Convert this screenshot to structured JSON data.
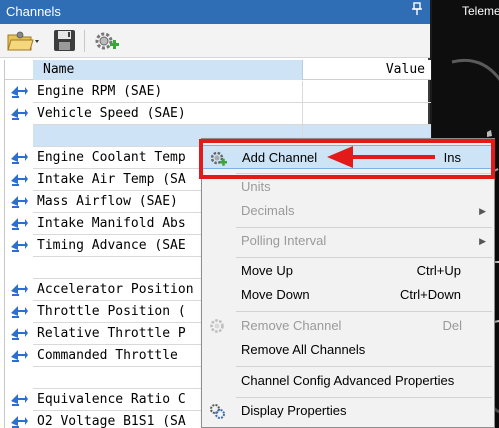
{
  "panel": {
    "title": "Channels",
    "pin_glyph": "ᵖ"
  },
  "right_panel": {
    "title": "Telemet"
  },
  "grid": {
    "columns": {
      "name": "Name",
      "value": "Value"
    },
    "rows": [
      {
        "name": "Engine RPM (SAE)",
        "icon": true
      },
      {
        "name": "Vehicle Speed (SAE)",
        "icon": true
      },
      {
        "name": "",
        "icon": false,
        "selected": true
      },
      {
        "name": "Engine Coolant Temp",
        "icon": true
      },
      {
        "name": "Intake Air Temp (SA",
        "icon": true
      },
      {
        "name": "Mass Airflow (SAE)",
        "icon": true
      },
      {
        "name": "Intake Manifold Abs",
        "icon": true
      },
      {
        "name": "Timing Advance (SAE",
        "icon": true
      },
      {
        "name": "",
        "icon": false
      },
      {
        "name": "Accelerator Position",
        "icon": true
      },
      {
        "name": "Throttle Position (",
        "icon": true
      },
      {
        "name": "Relative Throttle P",
        "icon": true
      },
      {
        "name": "Commanded Throttle",
        "icon": true
      },
      {
        "name": "",
        "icon": false
      },
      {
        "name": "Equivalence Ratio C",
        "icon": true
      },
      {
        "name": "O2 Voltage B1S1 (SA",
        "icon": true
      }
    ]
  },
  "menu": {
    "add_channel": "Add Channel",
    "add_channel_shortcut": "Ins",
    "units": "Units",
    "decimals": "Decimals",
    "polling_interval": "Polling Interval",
    "move_up": "Move Up",
    "move_up_shortcut": "Ctrl+Up",
    "move_down": "Move Down",
    "move_down_shortcut": "Ctrl+Down",
    "remove_channel": "Remove Channel",
    "remove_channel_shortcut": "Del",
    "remove_all_channels": "Remove All Channels",
    "channel_config": "Channel Config Advanced Properties",
    "display_properties": "Display Properties"
  },
  "colors": {
    "accent": "#2f6db5",
    "highlight": "#e21a1a",
    "selection": "#cfe3f7"
  }
}
